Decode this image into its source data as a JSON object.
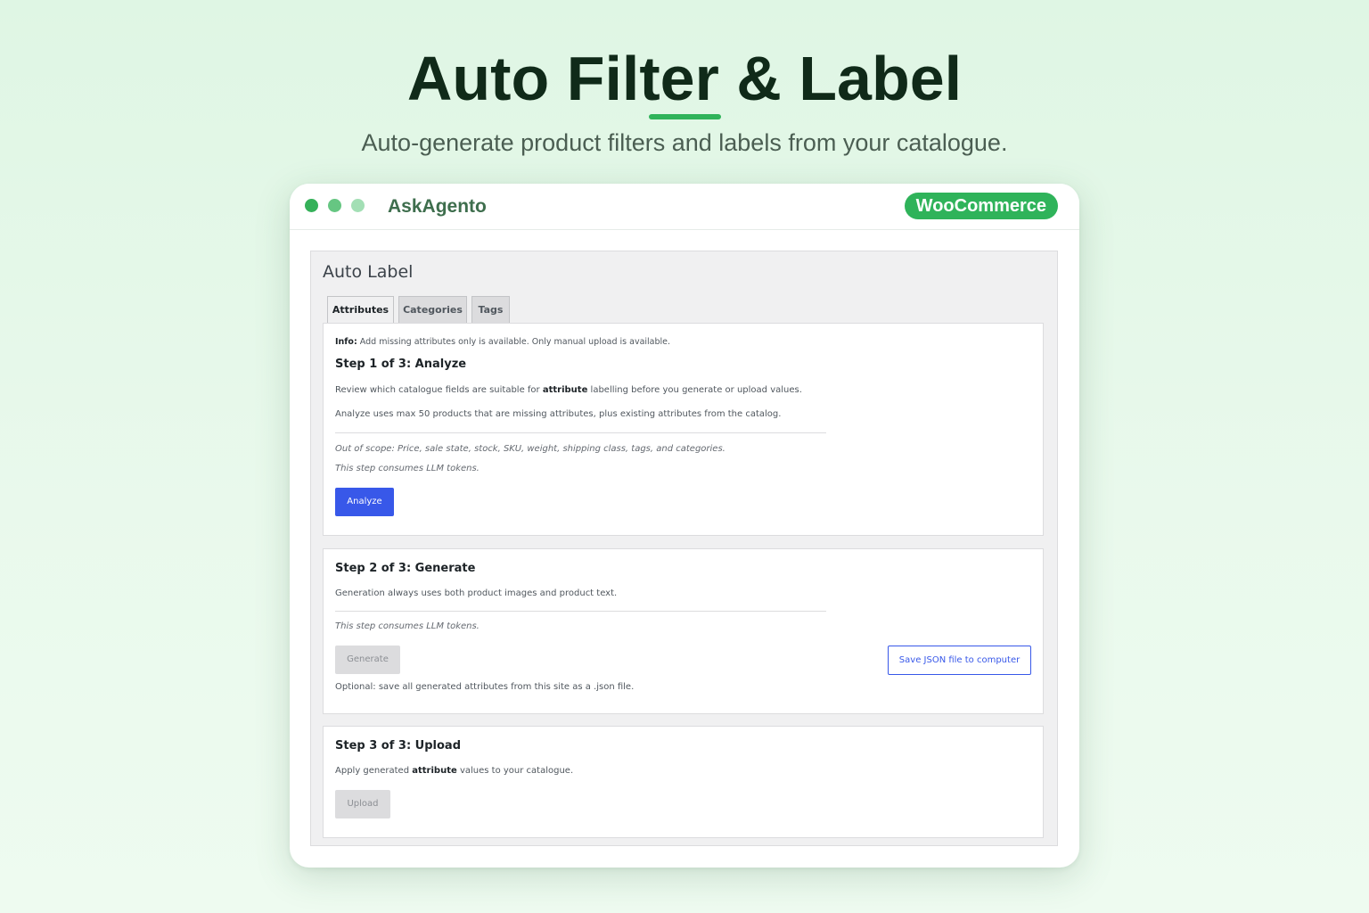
{
  "hero": {
    "title": "Auto Filter & Label",
    "subtitle": "Auto-generate product filters and labels from your catalogue."
  },
  "window": {
    "app_name": "AskAgento",
    "badge": "WooCommerce"
  },
  "page": {
    "title": "Auto Label",
    "tabs": [
      {
        "label": "Attributes",
        "active": true
      },
      {
        "label": "Categories",
        "active": false
      },
      {
        "label": "Tags",
        "active": false
      }
    ]
  },
  "step1": {
    "info_label": "Info:",
    "info_text": "Add missing attributes only is available. Only manual upload is available.",
    "heading": "Step 1 of 3: Analyze",
    "desc1_pre": "Review which catalogue fields are suitable for",
    "desc1_bold": "attribute",
    "desc1_post": "labelling before you generate or upload values.",
    "desc2": "Analyze uses max 50 products that are missing attributes, plus existing attributes from the catalog.",
    "note1": "Out of scope: Price, sale state, stock, SKU, weight, shipping class, tags, and categories.",
    "note2": "This step consumes LLM tokens.",
    "button": "Analyze"
  },
  "step2": {
    "heading": "Step 2 of 3: Generate",
    "desc": "Generation always uses both product images and product text.",
    "note": "This step consumes LLM tokens.",
    "button": "Generate",
    "save_button": "Save JSON file to computer",
    "optional": "Optional: save all generated attributes from this site as a .json file."
  },
  "step3": {
    "heading": "Step 3 of 3: Upload",
    "desc_pre": "Apply generated",
    "desc_bold": "attribute",
    "desc_post": "values to your catalogue.",
    "button": "Upload"
  },
  "colors": {
    "accent_green": "#2fb35a",
    "primary_blue": "#3858e9"
  }
}
